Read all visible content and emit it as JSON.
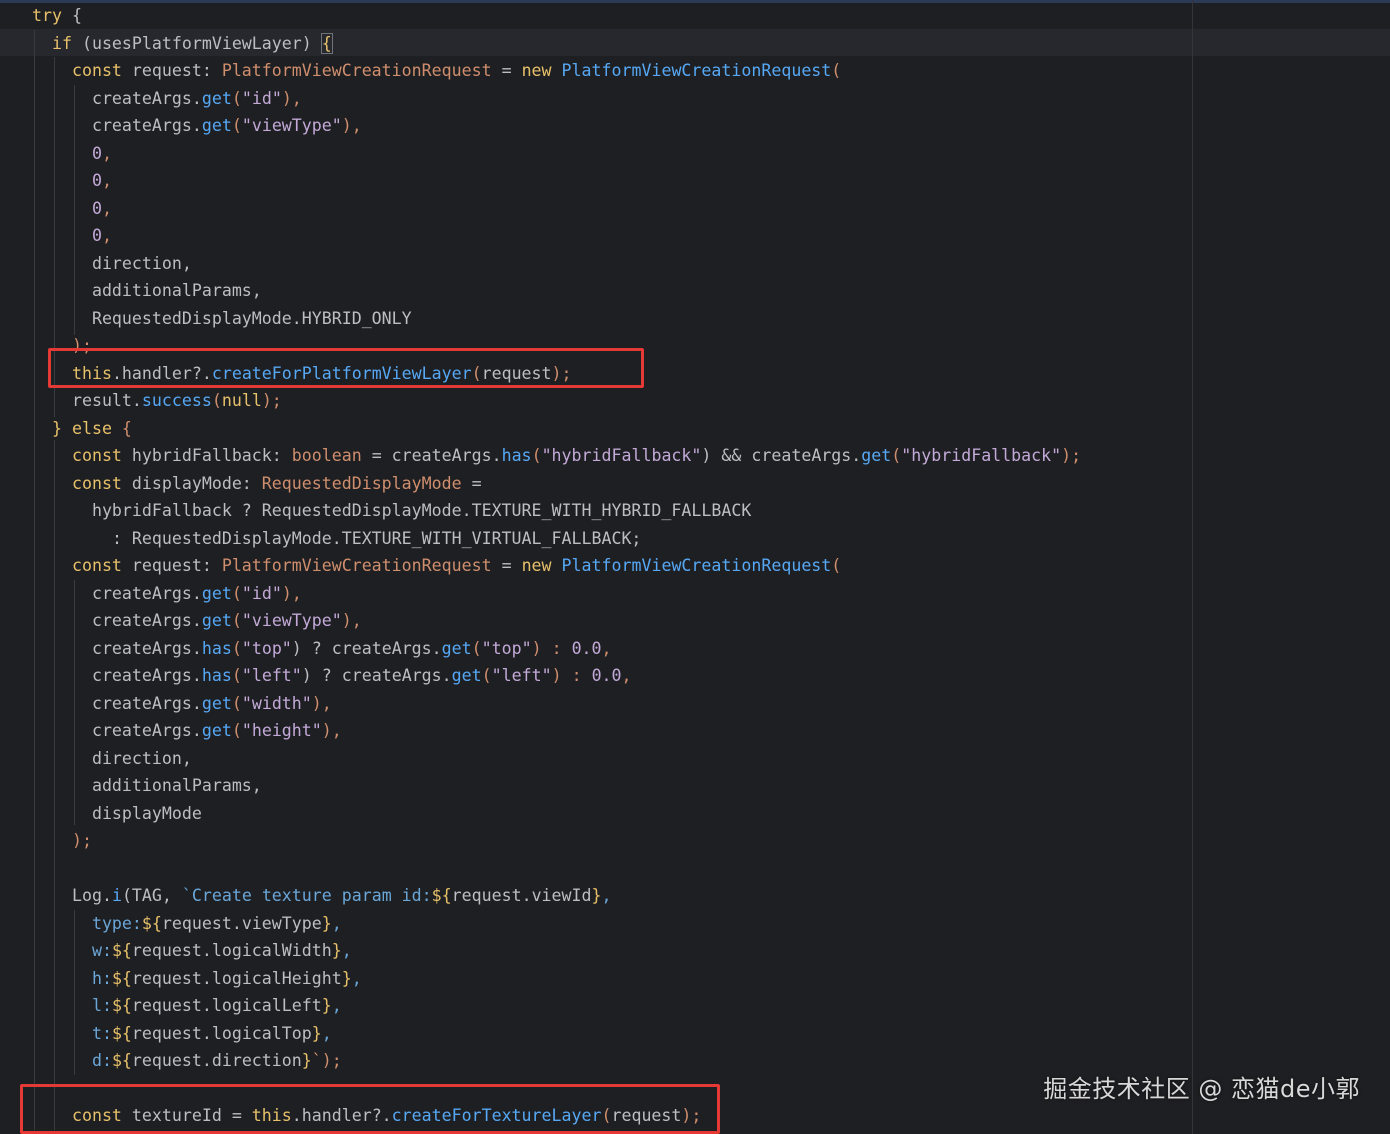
{
  "code_lines": [
    [
      "try",
      " {"
    ],
    [
      "if",
      " (usesPlatformViewLayer) ",
      "{"
    ],
    [
      "const",
      " request: ",
      "PlatformViewCreationRequest",
      " = ",
      "new",
      " ",
      "PlatformViewCreationRequest",
      "("
    ],
    [
      "createArgs.",
      "get",
      "(",
      "\"id\"",
      "),"
    ],
    [
      "createArgs.",
      "get",
      "(",
      "\"viewType\"",
      "),"
    ],
    [
      "0",
      ","
    ],
    [
      "0",
      ","
    ],
    [
      "0",
      ","
    ],
    [
      "0",
      ","
    ],
    [
      "direction,"
    ],
    [
      "additionalParams,"
    ],
    [
      "RequestedDisplayMode.HYBRID_ONLY"
    ],
    [
      ");"
    ],
    [
      "this",
      ".handler?.",
      "createForPlatformViewLayer",
      "(",
      "request",
      ");"
    ],
    [
      "result.",
      "success",
      "(",
      "null",
      ");"
    ],
    [
      "}",
      " else",
      " {"
    ],
    [
      "const",
      " hybridFallback: ",
      "boolean",
      " = createArgs.",
      "has",
      "(",
      "\"hybridFallback\"",
      ") && createArgs.",
      "get",
      "(",
      "\"hybridFallback\"",
      ");"
    ],
    [
      "const",
      " displayMode: ",
      "RequestedDisplayMode",
      " ="
    ],
    [
      "hybridFallback ? RequestedDisplayMode.TEXTURE_WITH_HYBRID_FALLBACK"
    ],
    [
      ": RequestedDisplayMode.TEXTURE_WITH_VIRTUAL_FALLBACK;"
    ],
    [
      "const",
      " request: ",
      "PlatformViewCreationRequest",
      " = ",
      "new",
      " ",
      "PlatformViewCreationRequest",
      "("
    ],
    [
      "createArgs.",
      "get",
      "(",
      "\"id\"",
      "),"
    ],
    [
      "createArgs.",
      "get",
      "(",
      "\"viewType\"",
      "),"
    ],
    [
      "createArgs.",
      "has",
      "(",
      "\"top\"",
      ") ? createArgs.",
      "get",
      "(",
      "\"top\"",
      ") : ",
      "0.0",
      ","
    ],
    [
      "createArgs.",
      "has",
      "(",
      "\"left\"",
      ") ? createArgs.",
      "get",
      "(",
      "\"left\"",
      ") : ",
      "0.0",
      ","
    ],
    [
      "createArgs.",
      "get",
      "(",
      "\"width\"",
      "),"
    ],
    [
      "createArgs.",
      "get",
      "(",
      "\"height\"",
      "),"
    ],
    [
      "direction,"
    ],
    [
      "additionalParams,"
    ],
    [
      "displayMode"
    ],
    [
      ");"
    ],
    [
      ""
    ],
    [
      "Log.",
      "i",
      "(TAG, ",
      "`Create texture param id:",
      "${",
      "request.viewId",
      "}",
      ","
    ],
    [
      "type:",
      "${",
      "request.viewType",
      "}",
      ","
    ],
    [
      "w:",
      "${",
      "request.logicalWidth",
      "}",
      ","
    ],
    [
      "h:",
      "${",
      "request.logicalHeight",
      "}",
      ","
    ],
    [
      "l:",
      "${",
      "request.logicalLeft",
      "}",
      ","
    ],
    [
      "t:",
      "${",
      "request.logicalTop",
      "}",
      ","
    ],
    [
      "d:",
      "${",
      "request.direction",
      "}",
      "`);"
    ],
    [
      ""
    ],
    [
      "const",
      " textureId = ",
      "this",
      ".handler?.",
      "createForTextureLayer",
      "(",
      "request",
      ");"
    ]
  ],
  "watermark": "掘金技术社区 @ 恋猫de小郭",
  "colors": {
    "background": "#1e1f22",
    "keyword": "#e7c06a",
    "type": "#cf8e6d",
    "method": "#56a8f5",
    "string": "#c3a9d8",
    "text": "#bcbec4",
    "highlight_box": "#e53935"
  }
}
